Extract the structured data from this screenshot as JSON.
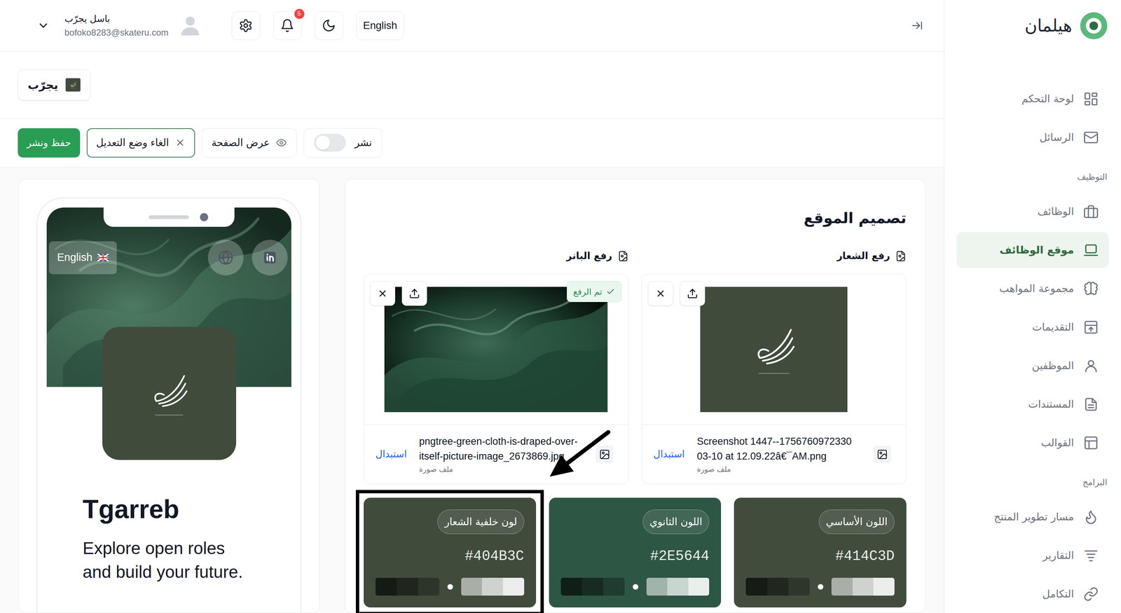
{
  "app": {
    "name": "هيلمان"
  },
  "sidebar": {
    "items": [
      {
        "kind": "link",
        "label": "لوحة التحكم",
        "selected": false
      },
      {
        "kind": "link",
        "label": "الرسائل",
        "selected": false
      },
      {
        "kind": "section",
        "label": "التوظيف"
      },
      {
        "kind": "link",
        "label": "الوظائف",
        "selected": false
      },
      {
        "kind": "link",
        "label": "موقع الوظائف",
        "selected": true
      },
      {
        "kind": "link",
        "label": "مجموعة المواهب",
        "selected": false
      },
      {
        "kind": "link",
        "label": "التقديمات",
        "selected": false
      },
      {
        "kind": "link",
        "label": "الموظفين",
        "selected": false
      },
      {
        "kind": "link",
        "label": "المستندات",
        "selected": false
      },
      {
        "kind": "link",
        "label": "القوالب",
        "selected": false
      },
      {
        "kind": "section",
        "label": "البرامج"
      },
      {
        "kind": "link",
        "label": "مسار تطوير المنتج",
        "selected": false
      },
      {
        "kind": "link",
        "label": "التقارير",
        "selected": false
      },
      {
        "kind": "link",
        "label": "التكامل",
        "selected": false
      }
    ]
  },
  "header": {
    "language": "English",
    "notifications": "5",
    "user": {
      "name": "باسل يجرّب",
      "email": "bofoko8283@skateru.com"
    }
  },
  "breadcrumb": {
    "label": "يجرّب"
  },
  "toolbar": {
    "save": "حفظ ونشر",
    "cancel": "الغاء وضع التعديل",
    "preview": "عرض الصفحة",
    "publish": {
      "label": "نشر",
      "on": false
    }
  },
  "design": {
    "title": "تصميم الموقع",
    "uploads": [
      {
        "kind": "logo",
        "label": "رفع الشعار",
        "file_lines": [
          "Screenshot 1447--1756760972330",
          "03-10 at 12.09.22â€¯AM.png"
        ],
        "file_type": "ملف صورة",
        "replace": "استبدال"
      },
      {
        "kind": "banner",
        "label": "رفع البانر",
        "badge": "تم الرفع",
        "file_lines": [
          "pngtree-green-cloth-is-draped-over-",
          "itself-picture-image_2673869.jpg"
        ],
        "file_type": "ملف صورة",
        "replace": "استبدال"
      }
    ],
    "colors": [
      {
        "label": "اللون الأساسي",
        "value": "#414C3D",
        "annotated": false
      },
      {
        "label": "اللون الثانوي",
        "value": "#2E5644",
        "annotated": false
      },
      {
        "label": "لون خلفية الشعار",
        "value": "#404B3C",
        "annotated": true
      }
    ]
  },
  "preview": {
    "language": "English",
    "title": "Tgarreb",
    "tagline": "Explore open roles and build your future."
  }
}
